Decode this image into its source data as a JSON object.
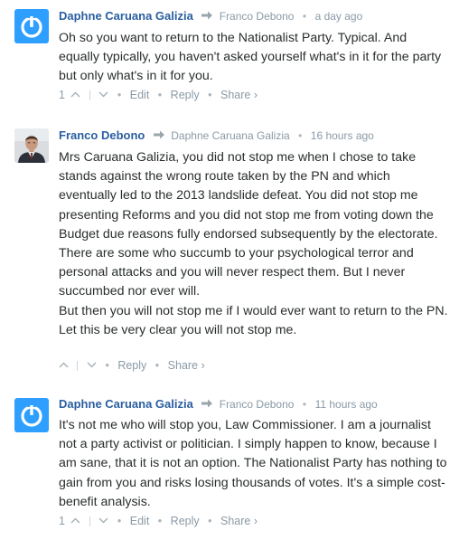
{
  "comments": [
    {
      "author": "Daphne Caruana Galizia",
      "reply_to": "Franco Debono",
      "time": "a day ago",
      "avatar": "disqus-logo-icon",
      "paragraphs": [
        "Oh so you want to return to the Nationalist Party. Typical. And equally typically, you haven't asked yourself what's in it for the party but only what's in it for you."
      ],
      "votes": "1",
      "actions": {
        "edit": "Edit",
        "reply": "Reply",
        "share": "Share ›"
      }
    },
    {
      "author": "Franco Debono",
      "reply_to": "Daphne Caruana Galizia",
      "time": "16 hours ago",
      "avatar": "user-photo",
      "paragraphs": [
        "Mrs Caruana Galizia, you did not stop me when I chose to take stands against the wrong route taken by the PN and which eventually led to the 2013 landslide defeat. You did not stop me presenting Reforms and you did not stop me from voting down the Budget due reasons fully endorsed subsequently by the electorate.",
        "There are some who succumb to your psychological terror and personal attacks and you will never respect them. But I never succumbed nor ever will.",
        "But then you will not stop me if I would ever want to return to the PN. Let this be very clear you will not stop me."
      ],
      "actions": {
        "reply": "Reply",
        "share": "Share ›"
      }
    },
    {
      "author": "Daphne Caruana Galizia",
      "reply_to": "Franco Debono",
      "time": "11 hours ago",
      "avatar": "disqus-logo-icon",
      "paragraphs": [
        "It's not me who will stop you, Law Commissioner. I am a journalist not a party activist or politician. I simply happen to know, because I am sane, that it is not an option. The Nationalist Party has nothing to gain from you and risks losing thousands of votes. It's a simple cost-benefit analysis."
      ],
      "votes": "1",
      "actions": {
        "edit": "Edit",
        "reply": "Reply",
        "share": "Share ›"
      }
    }
  ]
}
